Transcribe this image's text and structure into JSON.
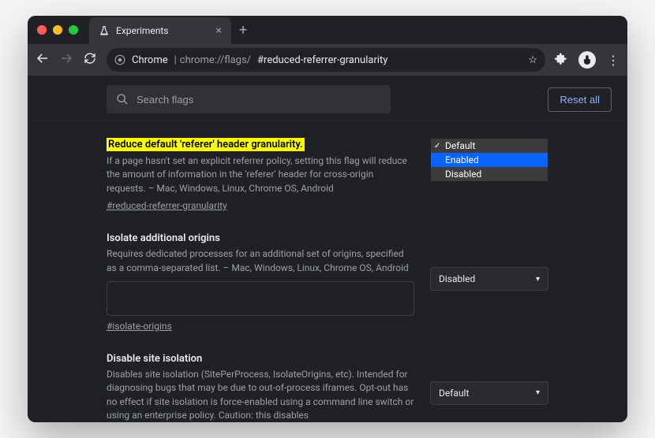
{
  "titlebar": {
    "tab_title": "Experiments",
    "tab_close": "×",
    "new_tab": "+"
  },
  "omnibox": {
    "prefix_label": "Chrome",
    "url_dim": "chrome://flags/",
    "url_bright": "#reduced-referrer-granularity"
  },
  "search": {
    "placeholder": "Search flags"
  },
  "reset_label": "Reset all",
  "flags": [
    {
      "title": "Reduce default 'referer' header granularity.",
      "desc": "If a page hasn't set an explicit referrer policy, setting this flag will reduce the amount of information in the 'referer' header for cross-origin requests. – Mac, Windows, Linux, Chrome OS, Android",
      "tag": "#reduced-referrer-granularity",
      "select_value": "Default",
      "highlighted": true,
      "dropdown_open": true,
      "dropdown": {
        "checked": "Default",
        "hover": "Enabled",
        "options": [
          "Default",
          "Enabled",
          "Disabled"
        ]
      }
    },
    {
      "title": "Isolate additional origins",
      "desc": "Requires dedicated processes for an additional set of origins, specified as a comma-separated list. – Mac, Windows, Linux, Chrome OS, Android",
      "tag": "#isolate-origins",
      "select_value": "Disabled",
      "has_input": true
    },
    {
      "title": "Disable site isolation",
      "desc": "Disables site isolation (SitePerProcess, IsolateOrigins, etc). Intended for diagnosing bugs that may be due to out-of-process iframes. Opt-out has no effect if site isolation is force-enabled using a command line switch or using an enterprise policy. Caution: this disables",
      "tag": "",
      "select_value": "Default"
    }
  ]
}
